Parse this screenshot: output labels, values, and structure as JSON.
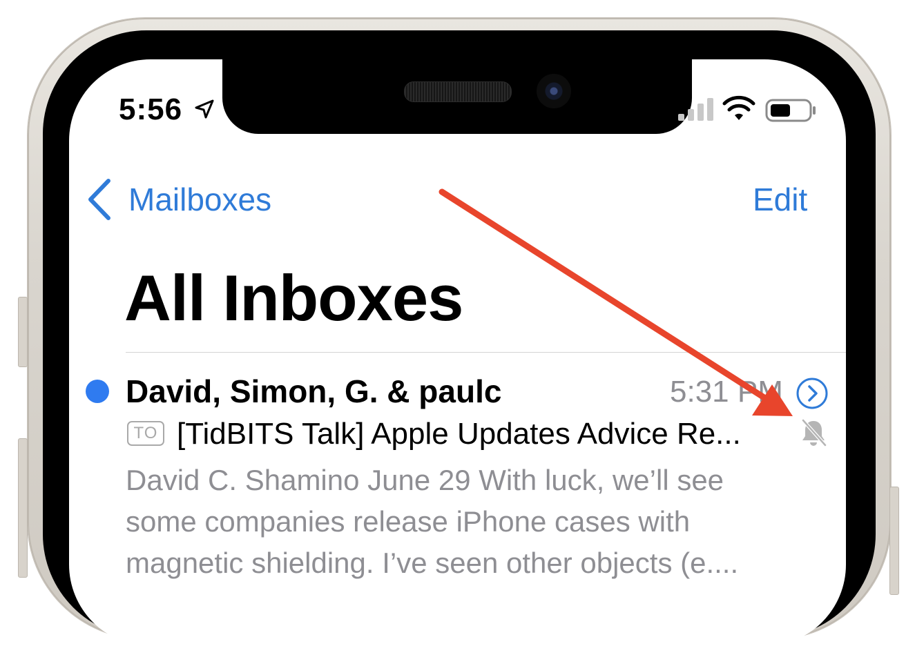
{
  "status_bar": {
    "time": "5:56",
    "location_icon": "location-arrow-icon",
    "signal_icon": "cellular-signal-icon",
    "wifi_icon": "wifi-icon",
    "battery_icon": "battery-icon"
  },
  "nav": {
    "back_label": "Mailboxes",
    "back_icon": "chevron-left-icon",
    "edit_label": "Edit"
  },
  "page_title": "All Inboxes",
  "message": {
    "unread": true,
    "sender": "David, Simon, G. & paulc",
    "time": "5:31 PM",
    "to_badge": "TO",
    "subject": "[TidBITS Talk] Apple Updates Advice Re...",
    "muted_icon": "bell-slash-icon",
    "preview_lines": [
      "David C. Shamino June 29 With luck, we’ll see",
      "some companies release iPhone cases with",
      "magnetic shielding. I’ve seen other objects (e...."
    ]
  },
  "colors": {
    "accent": "#2f7bd8",
    "unread_dot": "#2f7bf0",
    "annotation_arrow": "#e8452c",
    "secondary_text": "#8e8e93"
  }
}
